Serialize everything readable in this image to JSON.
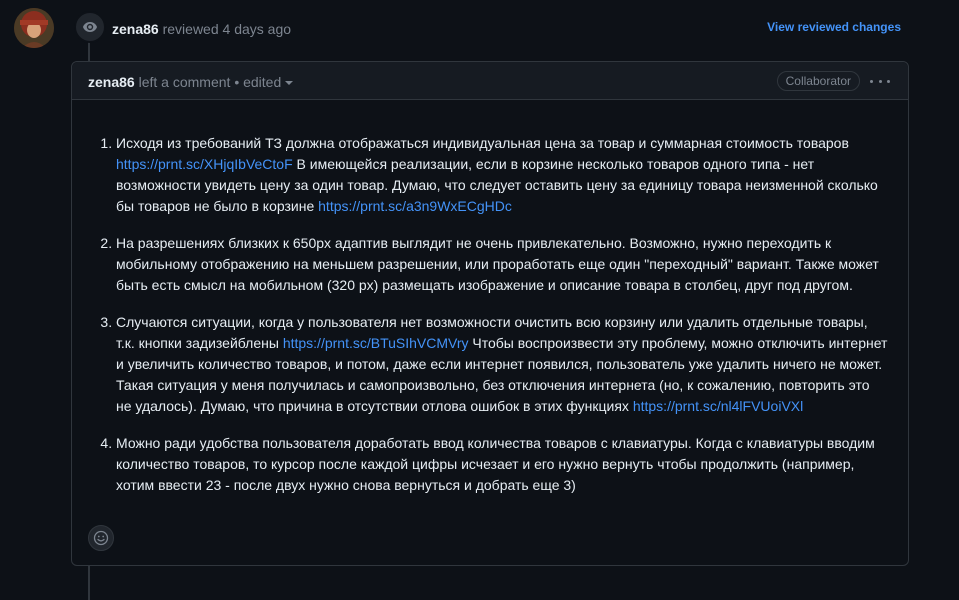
{
  "review": {
    "author": "zena86",
    "action": "reviewed",
    "time": "4 days ago",
    "view_changes_label": "View reviewed changes"
  },
  "comment": {
    "author": "zena86",
    "action": "left a comment",
    "separator": "•",
    "edited_label": "edited",
    "role_badge": "Collaborator",
    "items": [
      {
        "segments": [
          {
            "type": "text",
            "value": "Исходя из требований ТЗ должна отображаться индивидуальная цена за товар и суммарная стоимость товаров "
          },
          {
            "type": "link",
            "value": "https://prnt.sc/XHjqIbVeCtoF"
          },
          {
            "type": "text",
            "value": " В имеющейся реализации, если в корзине несколько товаров одного типа - нет возможности увидеть цену за один товар. Думаю, что следует оставить цену за единицу товара неизменной сколько бы товаров не было в корзине "
          },
          {
            "type": "link",
            "value": "https://prnt.sc/a3n9WxECgHDc"
          }
        ]
      },
      {
        "segments": [
          {
            "type": "text",
            "value": "На разрешениях близких к 650px адаптив выглядит не очень привлекательно. Возможно, нужно переходить к мобильному отображению на меньшем разрешении, или проработать еще один \"переходный\" вариант. Также может быть есть смысл на мобильном (320 px) размещать изображение и описание товара в столбец, друг под другом."
          }
        ]
      },
      {
        "segments": [
          {
            "type": "text",
            "value": "Случаются ситуации, когда у пользователя нет возможности очистить всю корзину или удалить отдельные товары, т.к. кнопки задизейблены "
          },
          {
            "type": "link",
            "value": "https://prnt.sc/BTuSIhVCMVry"
          },
          {
            "type": "text",
            "value": " Чтобы воспроизвести эту проблему, можно отключить интернет и увеличить количество товаров, и потом, даже если интернет появился, пользователь уже удалить ничего не может. Такая ситуация у меня получилась и самопроизвольно, без отключения интернета (но, к сожалению, повторить это не удалось). Думаю, что причина в отсутствии отлова ошибок в этих функциях "
          },
          {
            "type": "link",
            "value": "https://prnt.sc/nl4lFVUoiVXl"
          }
        ]
      },
      {
        "segments": [
          {
            "type": "text",
            "value": "Можно ради удобства пользователя доработать ввод количества товаров с клавиатуры. Когда с клавиатуры вводим количество товаров, то курсор после каждой цифры исчезает и его нужно вернуть чтобы продолжить (например, хотим ввести 23 - после двух нужно снова вернуться и добрать еще 3)"
          }
        ]
      }
    ]
  },
  "icons": {
    "eye": "eye-icon",
    "kebab": "kebab-horizontal-icon",
    "smiley": "smiley-icon",
    "caret": "triangle-down-icon"
  },
  "colors": {
    "background": "#0d1117",
    "header_bg": "#161b22",
    "border": "#30363d",
    "text": "#e6edf3",
    "muted": "#7d8590",
    "link": "#4493f8"
  }
}
